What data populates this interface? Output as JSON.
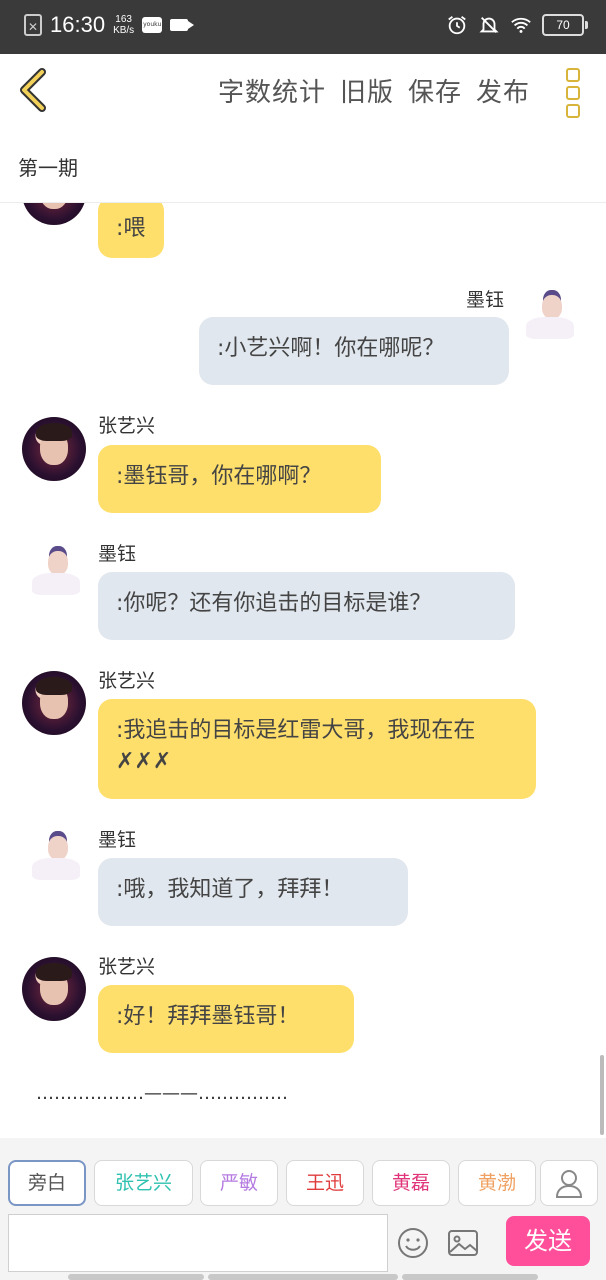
{
  "status_bar": {
    "time": "16:30",
    "speed_value": "163",
    "speed_unit": "KB/s",
    "youku": "youku",
    "battery": "70"
  },
  "toolbar": {
    "items": [
      "字数统计",
      "旧版",
      "保存",
      "发布"
    ]
  },
  "episode": {
    "title": "第一期"
  },
  "messages": [
    {
      "speaker": "",
      "text": ":喂",
      "side": "left",
      "avatar": "zyx"
    },
    {
      "speaker": "墨钰",
      "text": ":小艺兴啊！你在哪呢？",
      "side": "right",
      "avatar": "my"
    },
    {
      "speaker": "张艺兴",
      "text": ":墨钰哥，你在哪啊？",
      "side": "left",
      "avatar": "zyx"
    },
    {
      "speaker": "墨钰",
      "text": ":你呢？还有你追击的目标是谁？",
      "side": "left",
      "avatar": "my"
    },
    {
      "speaker": "张艺兴",
      "text": ":我追击的目标是红雷大哥，我现在在✗✗✗",
      "side": "left",
      "avatar": "zyx"
    },
    {
      "speaker": "墨钰",
      "text": ":哦，我知道了，拜拜！",
      "side": "left",
      "avatar": "my"
    },
    {
      "speaker": "张艺兴",
      "text": ":好！拜拜墨钰哥！",
      "side": "left",
      "avatar": "zyx"
    }
  ],
  "divider": "………………———……………",
  "characters": [
    {
      "label": "旁白",
      "color": "#555555"
    },
    {
      "label": "张艺兴",
      "color": "#2fc1b0"
    },
    {
      "label": "严敏",
      "color": "#b57be0"
    },
    {
      "label": "王迅",
      "color": "#e03c3c"
    },
    {
      "label": "黄磊",
      "color": "#e0357a"
    },
    {
      "label": "黄渤",
      "color": "#f0a060"
    }
  ],
  "input": {
    "placeholder": "",
    "value": ""
  },
  "send_label": "发送",
  "colors": {
    "yellow_bubble": "#ffdf6b",
    "gray_bubble": "#e1e7ee",
    "send": "#ff4f9a",
    "accent": "#d8b53a"
  }
}
